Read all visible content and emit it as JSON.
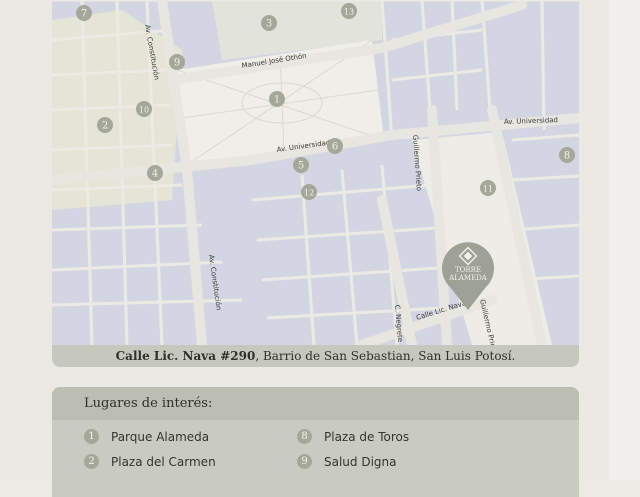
{
  "map": {
    "streets": [
      "Manuel José Othón",
      "Av. Universidad",
      "Av. Universidad",
      "Av. Constitución",
      "Av. Constitución",
      "Guillermo Prieto",
      "Guillermo Prieto",
      "Calle Lic. Nava",
      "C. Negrete"
    ],
    "markers": [
      "1",
      "2",
      "3",
      "4",
      "5",
      "6",
      "7",
      "8",
      "9",
      "10",
      "11",
      "12",
      "13"
    ],
    "brand": {
      "line1": "TORRE",
      "line2": "ALAMEDA"
    },
    "colors": {
      "block": "#d2d5e1",
      "street": "#eceae4",
      "park": "#f0eee8",
      "highlight": "#e8e8d2",
      "marker": "#a4a79a",
      "brand_pin": "#9ea196"
    }
  },
  "address": {
    "bold": "Calle Lic. Nava #290",
    "rest": ", Barrio de San Sebastian, San Luis Potosí."
  },
  "poi": {
    "title": "Lugares de interés:",
    "items": [
      {
        "num": "1",
        "label": "Parque Alameda"
      },
      {
        "num": "2",
        "label": "Plaza del Carmen"
      },
      {
        "num": "8",
        "label": "Plaza de Toros"
      },
      {
        "num": "9",
        "label": "Salud Digna"
      }
    ]
  }
}
